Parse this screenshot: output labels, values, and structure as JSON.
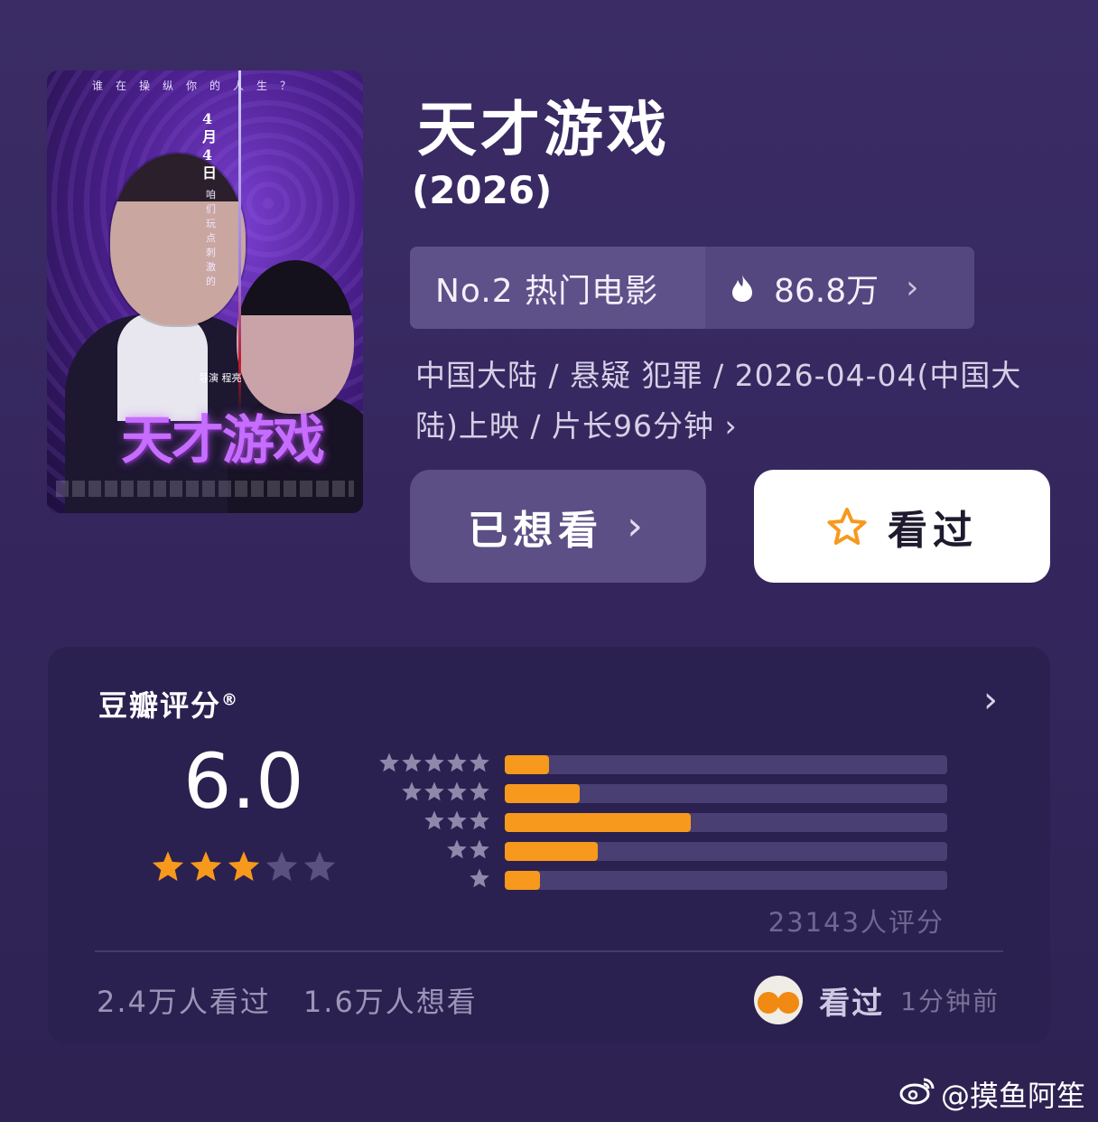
{
  "poster": {
    "tagline": "谁在操纵你的人生？",
    "date": "4月4日",
    "slogan": "咱们玩点刺激的",
    "director": "导演 程亮",
    "logo_text": "天才游戏"
  },
  "movie": {
    "title": "天才游戏",
    "year": "(2026)",
    "rank_label": "No.2 热门电影",
    "heat": "86.8万",
    "meta": "中国大陆 / 悬疑 犯罪 / 2026-04-04(中国大陆)上映 / 片长96分钟 ›"
  },
  "actions": {
    "want_label": "已想看",
    "seen_label": "看过"
  },
  "rating": {
    "title": "豆瓣评分",
    "registered": "®",
    "score": "6.0",
    "stars_filled": 3,
    "stars_total": 5,
    "distribution": [
      {
        "stars": 5,
        "fraction": 0.1
      },
      {
        "stars": 4,
        "fraction": 0.17
      },
      {
        "stars": 3,
        "fraction": 0.42
      },
      {
        "stars": 2,
        "fraction": 0.21
      },
      {
        "stars": 1,
        "fraction": 0.08
      }
    ],
    "count": "23143人评分",
    "seen_count": "2.4万人看过",
    "want_count": "1.6万人想看",
    "activity_label": "看过",
    "activity_time": "1分钟前"
  },
  "watermark": "@摸鱼阿笙",
  "colors": {
    "background": "#3b2c66",
    "card": "#2b2150",
    "accent": "#f7991c",
    "star_empty": "#5a5180"
  },
  "icons": [
    "fire-icon",
    "chevron-right-icon",
    "star-outline-icon",
    "star-icon",
    "weibo-icon"
  ]
}
